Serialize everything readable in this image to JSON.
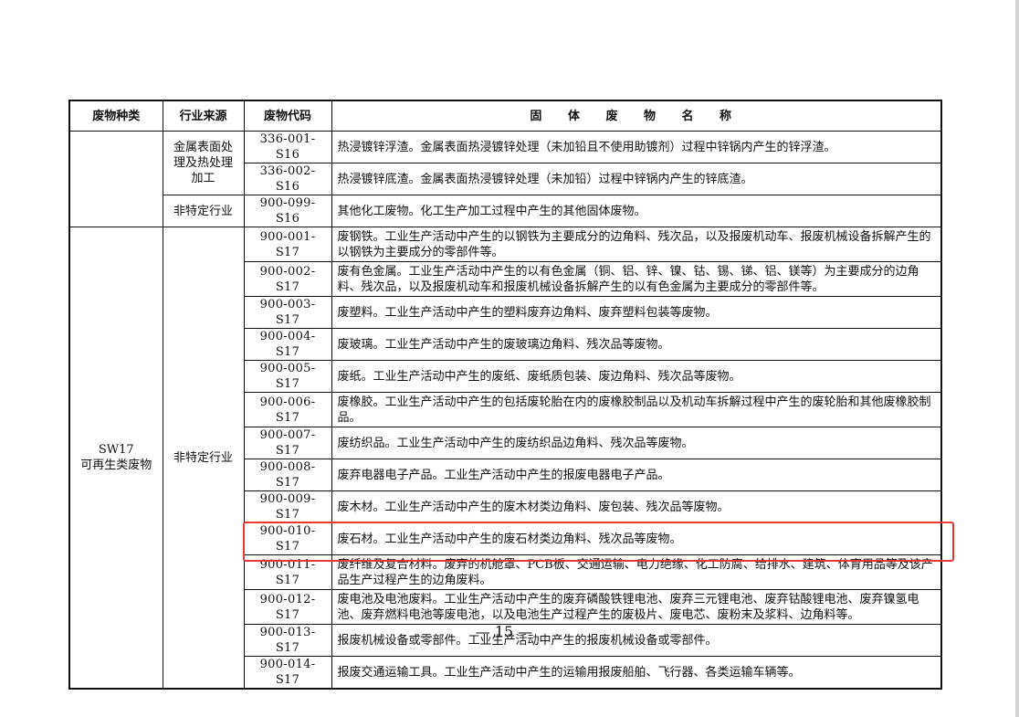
{
  "table": {
    "headers": {
      "category": "废物种类",
      "industry": "行业来源",
      "code": "废物代码",
      "name": "固 体 废 物 名 称"
    },
    "rows": [
      {
        "category": "",
        "industry": "金属表面处理及热处理加工",
        "code": "336-001-S16",
        "desc": "热浸镀锌浮渣。金属表面热浸镀锌处理（未加铅且不使用助镀剂）过程中锌锅内产生的锌浮渣。"
      },
      {
        "code": "336-002-S16",
        "desc": "热浸镀锌底渣。金属表面热浸镀锌处理（未加铅）过程中锌锅内产生的锌底渣。"
      },
      {
        "industry": "非特定行业",
        "code": "900-099-S16",
        "desc": "其他化工废物。化工生产加工过程中产生的其他固体废物。"
      },
      {
        "category": "SW17\n可再生类废物",
        "industry": "非特定行业",
        "code": "900-001-S17",
        "desc": "废钢铁。工业生产活动中产生的以钢铁为主要成分的边角料、残次品，以及报废机动车、报废机械设备拆解产生的以钢铁为主要成分的零部件等。"
      },
      {
        "code": "900-002-S17",
        "desc": "废有色金属。工业生产活动中产生的以有色金属（铜、铝、锌、镍、钴、锡、锑、铝、镁等）为主要成分的边角料、残次品，以及报废机动车和报废机械设备拆解产生的以有色金属为主要成分的零部件等。"
      },
      {
        "code": "900-003-S17",
        "desc": "废塑料。工业生产活动中产生的塑料废弃边角料、废弃塑料包装等废物。"
      },
      {
        "code": "900-004-S17",
        "desc": "废玻璃。工业生产活动中产生的废玻璃边角料、残次品等废物。"
      },
      {
        "code": "900-005-S17",
        "desc": "废纸。工业生产活动中产生的废纸、废纸质包装、废边角料、残次品等废物。"
      },
      {
        "code": "900-006-S17",
        "desc": "废橡胶。工业生产活动中产生的包括废轮胎在内的废橡胶制品以及机动车拆解过程中产生的废轮胎和其他废橡胶制品。"
      },
      {
        "code": "900-007-S17",
        "desc": "废纺织品。工业生产活动中产生的废纺织品边角料、残次品等废物。"
      },
      {
        "code": "900-008-S17",
        "desc": "废弃电器电子产品。工业生产活动中产生的报废电器电子产品。"
      },
      {
        "code": "900-009-S17",
        "desc": "废木材。工业生产活动中产生的废木材类边角料、废包装、残次品等废物。"
      },
      {
        "code": "900-010-S17",
        "desc": "废石材。工业生产活动中产生的废石材类边角料、残次品等废物。"
      },
      {
        "code": "900-011-S17",
        "desc": "废纤维及复合材料。废弃的机舱罩、PCB板、交通运输、电力绝缘、化工防腐、给排水、建筑、体育用品等及该产品生产过程产生的边角废料。"
      },
      {
        "code": "900-012-S17",
        "desc": "废电池及电池废料。工业生产活动中产生的废弃磷酸铁锂电池、废弃三元锂电池、废弃钴酸锂电池、废弃镍氢电池、废弃燃料电池等废电池，以及电池生产过程产生的废极片、废电芯、废粉末及浆料、边角料等。"
      },
      {
        "code": "900-013-S17",
        "desc": "报废机械设备或零部件。工业生产活动中产生的报废机械设备或零部件。"
      },
      {
        "code": "900-014-S17",
        "desc": "报废交通运输工具。工业生产活动中产生的运输用报废船舶、飞行器、各类运输车辆等。"
      }
    ]
  },
  "page_number": "— 15 —",
  "highlight_color": "#e53935"
}
